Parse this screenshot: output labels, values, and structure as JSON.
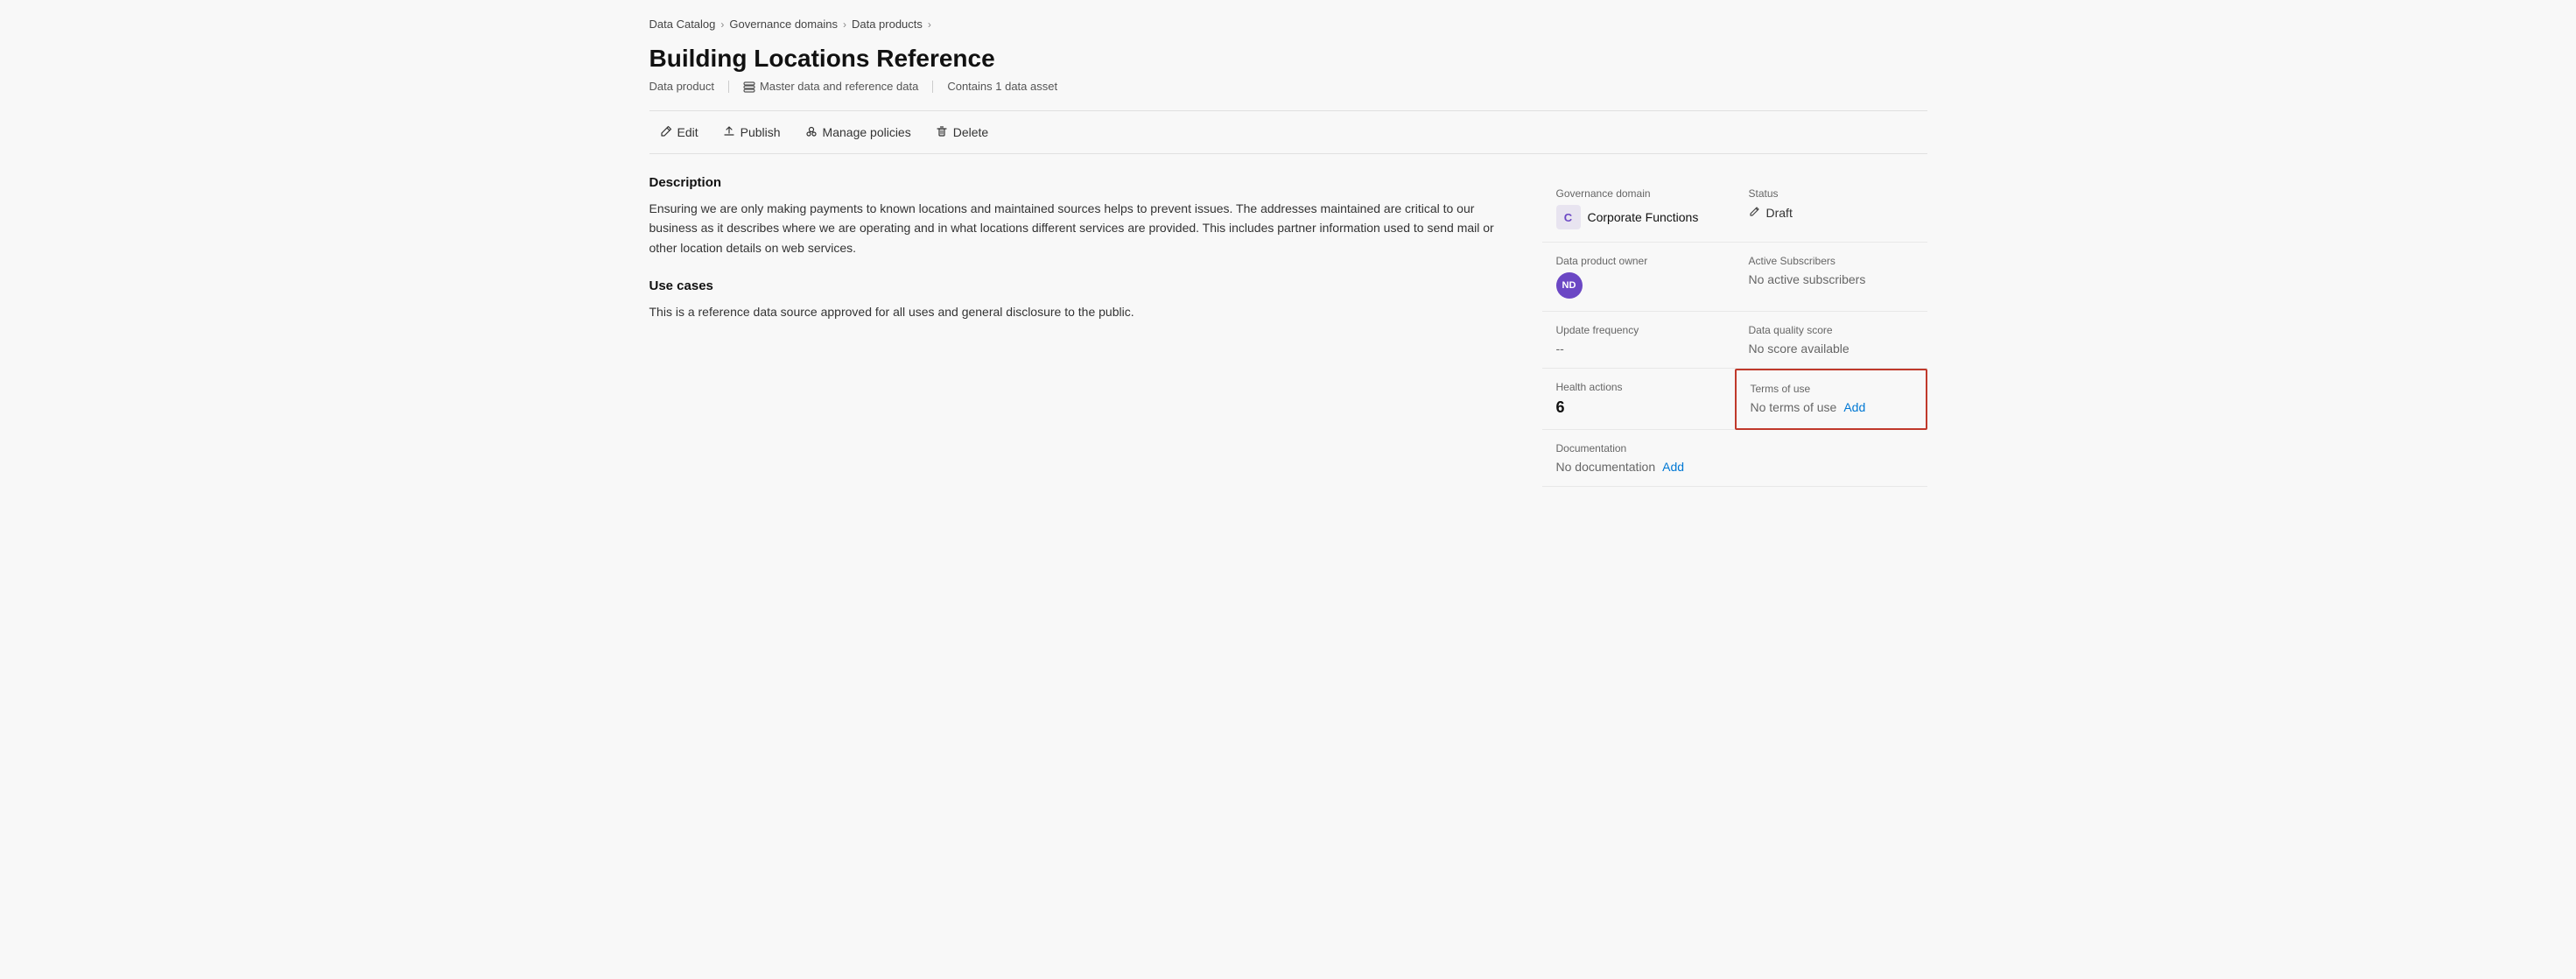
{
  "breadcrumb": {
    "items": [
      {
        "label": "Data Catalog",
        "href": "#"
      },
      {
        "label": "Governance domains",
        "href": "#"
      },
      {
        "label": "Data products",
        "href": "#"
      }
    ]
  },
  "page": {
    "title": "Building Locations Reference",
    "subtitle_type": "Data product",
    "subtitle_category_icon": "database-icon",
    "subtitle_category": "Master data and reference data",
    "subtitle_assets": "Contains 1 data asset"
  },
  "toolbar": {
    "edit_label": "Edit",
    "publish_label": "Publish",
    "manage_policies_label": "Manage policies",
    "delete_label": "Delete"
  },
  "description": {
    "title": "Description",
    "text": "Ensuring we are only making payments to known locations and maintained sources helps to prevent issues.  The addresses maintained are critical to our business as it describes where we are operating and in what locations different services are provided.  This includes partner information used to send mail or other location details on web services."
  },
  "use_cases": {
    "title": "Use cases",
    "text": "This is a reference data source approved for all uses and general disclosure to the public."
  },
  "sidebar": {
    "governance_domain_label": "Governance domain",
    "governance_domain_badge": "C",
    "governance_domain_name": "Corporate Functions",
    "status_label": "Status",
    "status_value": "Draft",
    "data_product_owner_label": "Data product owner",
    "owner_initials": "ND",
    "active_subscribers_label": "Active Subscribers",
    "active_subscribers_value": "No active subscribers",
    "update_frequency_label": "Update frequency",
    "update_frequency_value": "--",
    "data_quality_score_label": "Data quality score",
    "data_quality_score_value": "No score available",
    "health_actions_label": "Health actions",
    "health_actions_value": "6",
    "terms_of_use_label": "Terms of use",
    "terms_of_use_value": "No terms of use",
    "terms_add_label": "Add",
    "documentation_label": "Documentation",
    "documentation_value": "No documentation",
    "documentation_add_label": "Add"
  }
}
